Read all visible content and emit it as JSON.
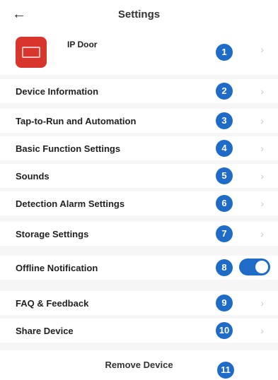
{
  "header": {
    "title": "Settings",
    "back_icon": "←"
  },
  "device": {
    "name": "IP Door",
    "icon": "doorbell-camera-icon",
    "icon_color": "#d8352c"
  },
  "rows": [
    {
      "label": "Device Information",
      "badge": "2"
    },
    {
      "label": "Tap-to-Run and Automation",
      "badge": "3"
    },
    {
      "label": "Basic Function Settings",
      "badge": "4"
    },
    {
      "label": "Sounds",
      "badge": "5"
    },
    {
      "label": "Detection Alarm Settings",
      "badge": "6"
    },
    {
      "label": "Storage Settings",
      "badge": "7"
    },
    {
      "label": "Offline Notification",
      "badge": "8"
    },
    {
      "label": "FAQ & Feedback",
      "badge": "9"
    },
    {
      "label": "Share Device",
      "badge": "10"
    }
  ],
  "device_badge": "1",
  "offline_notification_enabled": true,
  "remove": {
    "label": "Remove Device",
    "badge": "11"
  },
  "chevron": "›",
  "colors": {
    "accent": "#1e6cc7",
    "background": "#f6f6f6"
  }
}
